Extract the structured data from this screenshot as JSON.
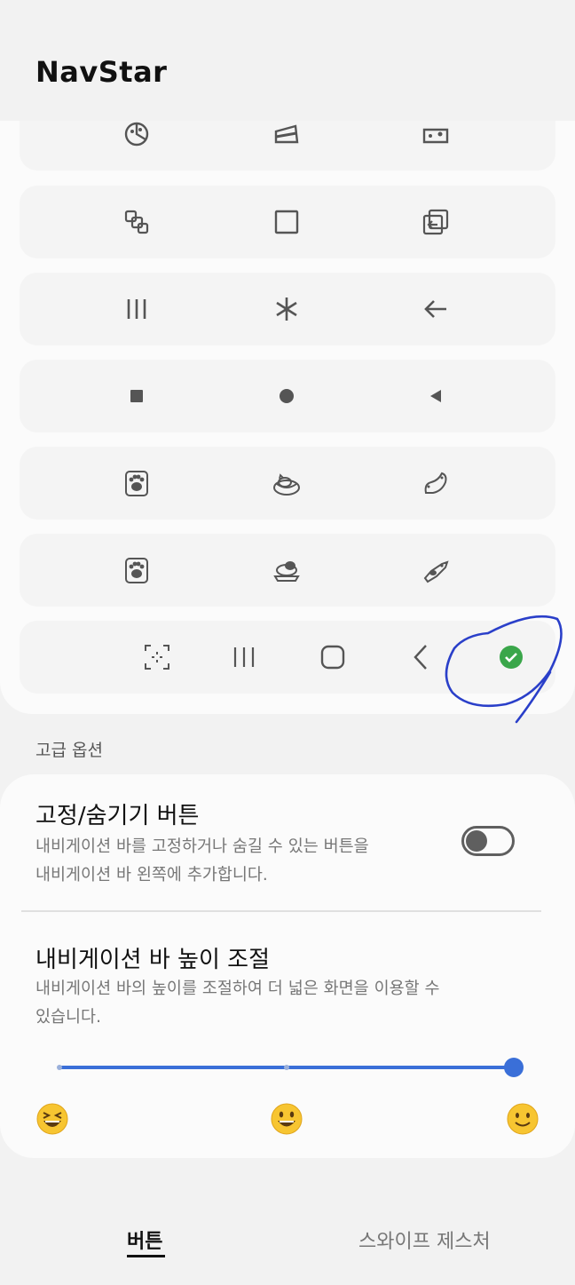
{
  "header": {
    "title": "NavStar"
  },
  "nav_styles": {
    "rows": [
      {
        "icons": [
          "pizza-icon",
          "cake-icon",
          "cheese-icon"
        ]
      },
      {
        "icons": [
          "recent-apps-squares-icon",
          "home-square-icon",
          "back-box-icon"
        ]
      },
      {
        "icons": [
          "three-bars-icon",
          "asterisk-icon",
          "arrow-left-icon"
        ]
      },
      {
        "icons": [
          "filled-square-icon",
          "filled-circle-icon",
          "filled-triangle-left-icon"
        ]
      },
      {
        "icons": [
          "cat-paw-icon",
          "sleeping-cat-icon",
          "playing-cat-icon"
        ]
      },
      {
        "icons": [
          "dog-paw-icon",
          "sleeping-dog-icon",
          "playing-dog-icon"
        ]
      }
    ],
    "selected_row": {
      "icons": [
        "screenshot-dashed-icon",
        "recent-apps-icon",
        "home-rounded-square-icon",
        "back-chevron-icon"
      ],
      "selected_check": "check-circle-icon",
      "accent": "#3aa64a",
      "annotation_color": "#2a3fc9"
    }
  },
  "advanced": {
    "section_label": "고급 옵션",
    "pin_hide": {
      "title": "고정/숨기기 버튼",
      "description_line1": "내비게이션 바를 고정하거나 숨길 수 있는 버튼을",
      "description_line2": "내비게이션 바 왼쪽에 추가합니다.",
      "enabled": false
    },
    "height_adjust": {
      "title": "내비게이션 바 높이 조절",
      "description_line1": "내비게이션 바의 높이를 조절하여 더 넓은 화면을 이용할 수",
      "description_line2": "있습니다.",
      "slider_position": 1.0,
      "slider_steps": 3,
      "emojis": [
        "laughing-squint-emoji",
        "grinning-emoji",
        "slight-smile-emoji"
      ],
      "accent": "#3a6fd8"
    }
  },
  "tabs": {
    "buttons": "버튼",
    "swipe": "스와이프 제스처"
  }
}
